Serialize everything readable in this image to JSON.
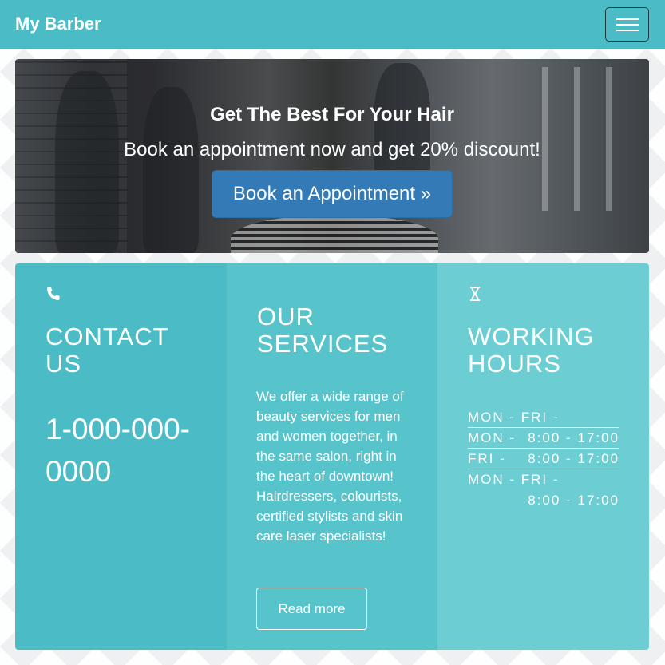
{
  "navbar": {
    "brand": "My Barber",
    "menu_icon": "hamburger-icon"
  },
  "hero": {
    "title": "Get The Best For Your Hair",
    "subtitle": "Book an appointment now and get 20% discount!",
    "button_label": "Book an Appointment »"
  },
  "contact": {
    "icon": "phone-icon",
    "heading": "CONTACT US",
    "phone": "1-000-000-0000"
  },
  "services": {
    "heading": "OUR SERVICES",
    "text": "We offer a wide range of beauty services for men and women together, in the same salon, right in the heart of downtown! Hairdressers, colourists, certified stylists and skin care laser specialists!",
    "button_label": "Read more"
  },
  "hours": {
    "icon": "hourglass-icon",
    "heading": "WORKING HOURS",
    "rows": [
      {
        "day": "MON - FRI -",
        "time": ""
      },
      {
        "day": "MON -",
        "time": "8:00 - 17:00"
      },
      {
        "day": "FRI -",
        "time": "8:00 - 17:00"
      },
      {
        "day": "MON - FRI -",
        "time": "8:00 - 17:00"
      }
    ]
  },
  "colors": {
    "navbar": "#4bbcc6",
    "contact_panel": "#4bbcc6",
    "services_panel": "#57c3cb",
    "hours_panel": "#6ccdd3",
    "primary_button": "#337ab7"
  }
}
